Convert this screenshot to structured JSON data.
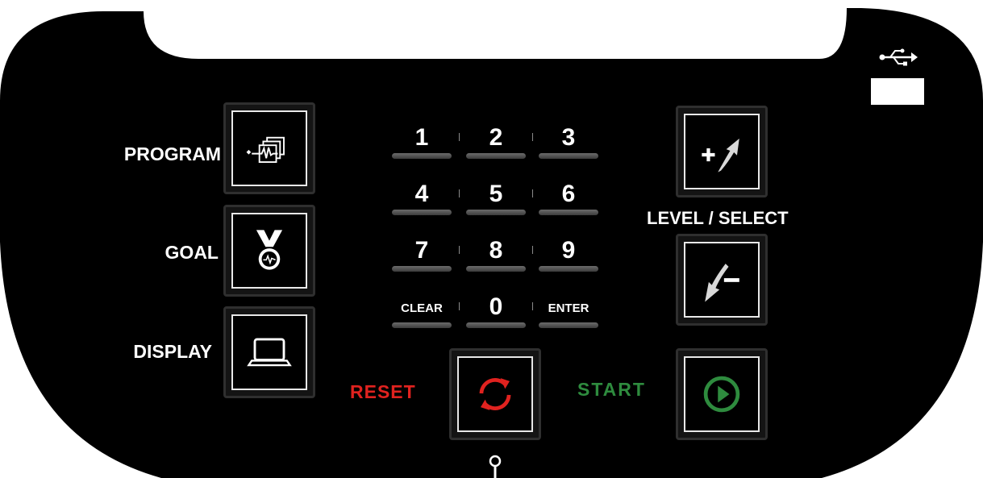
{
  "labels": {
    "program": "PROGRAM",
    "goal": "GOAL",
    "display": "DISPLAY",
    "level_select": "LEVEL / SELECT",
    "reset": "RESET",
    "start": "START"
  },
  "keypad": [
    {
      "label": "1"
    },
    {
      "label": "2"
    },
    {
      "label": "3"
    },
    {
      "label": "4"
    },
    {
      "label": "5"
    },
    {
      "label": "6"
    },
    {
      "label": "7"
    },
    {
      "label": "8"
    },
    {
      "label": "9"
    },
    {
      "label": "CLEAR"
    },
    {
      "label": "0"
    },
    {
      "label": "ENTER"
    }
  ],
  "icons": {
    "program": "heart-chart-icon",
    "goal": "medal-icon",
    "display": "laptop-icon",
    "level_up": "plus-arrow-up-icon",
    "level_down": "minus-arrow-down-icon",
    "reset": "refresh-icon",
    "start": "play-icon",
    "usb": "usb-icon"
  },
  "colors": {
    "panel": "#000000",
    "reset": "#e0221f",
    "start": "#2e8b3e",
    "text": "#ffffff"
  }
}
